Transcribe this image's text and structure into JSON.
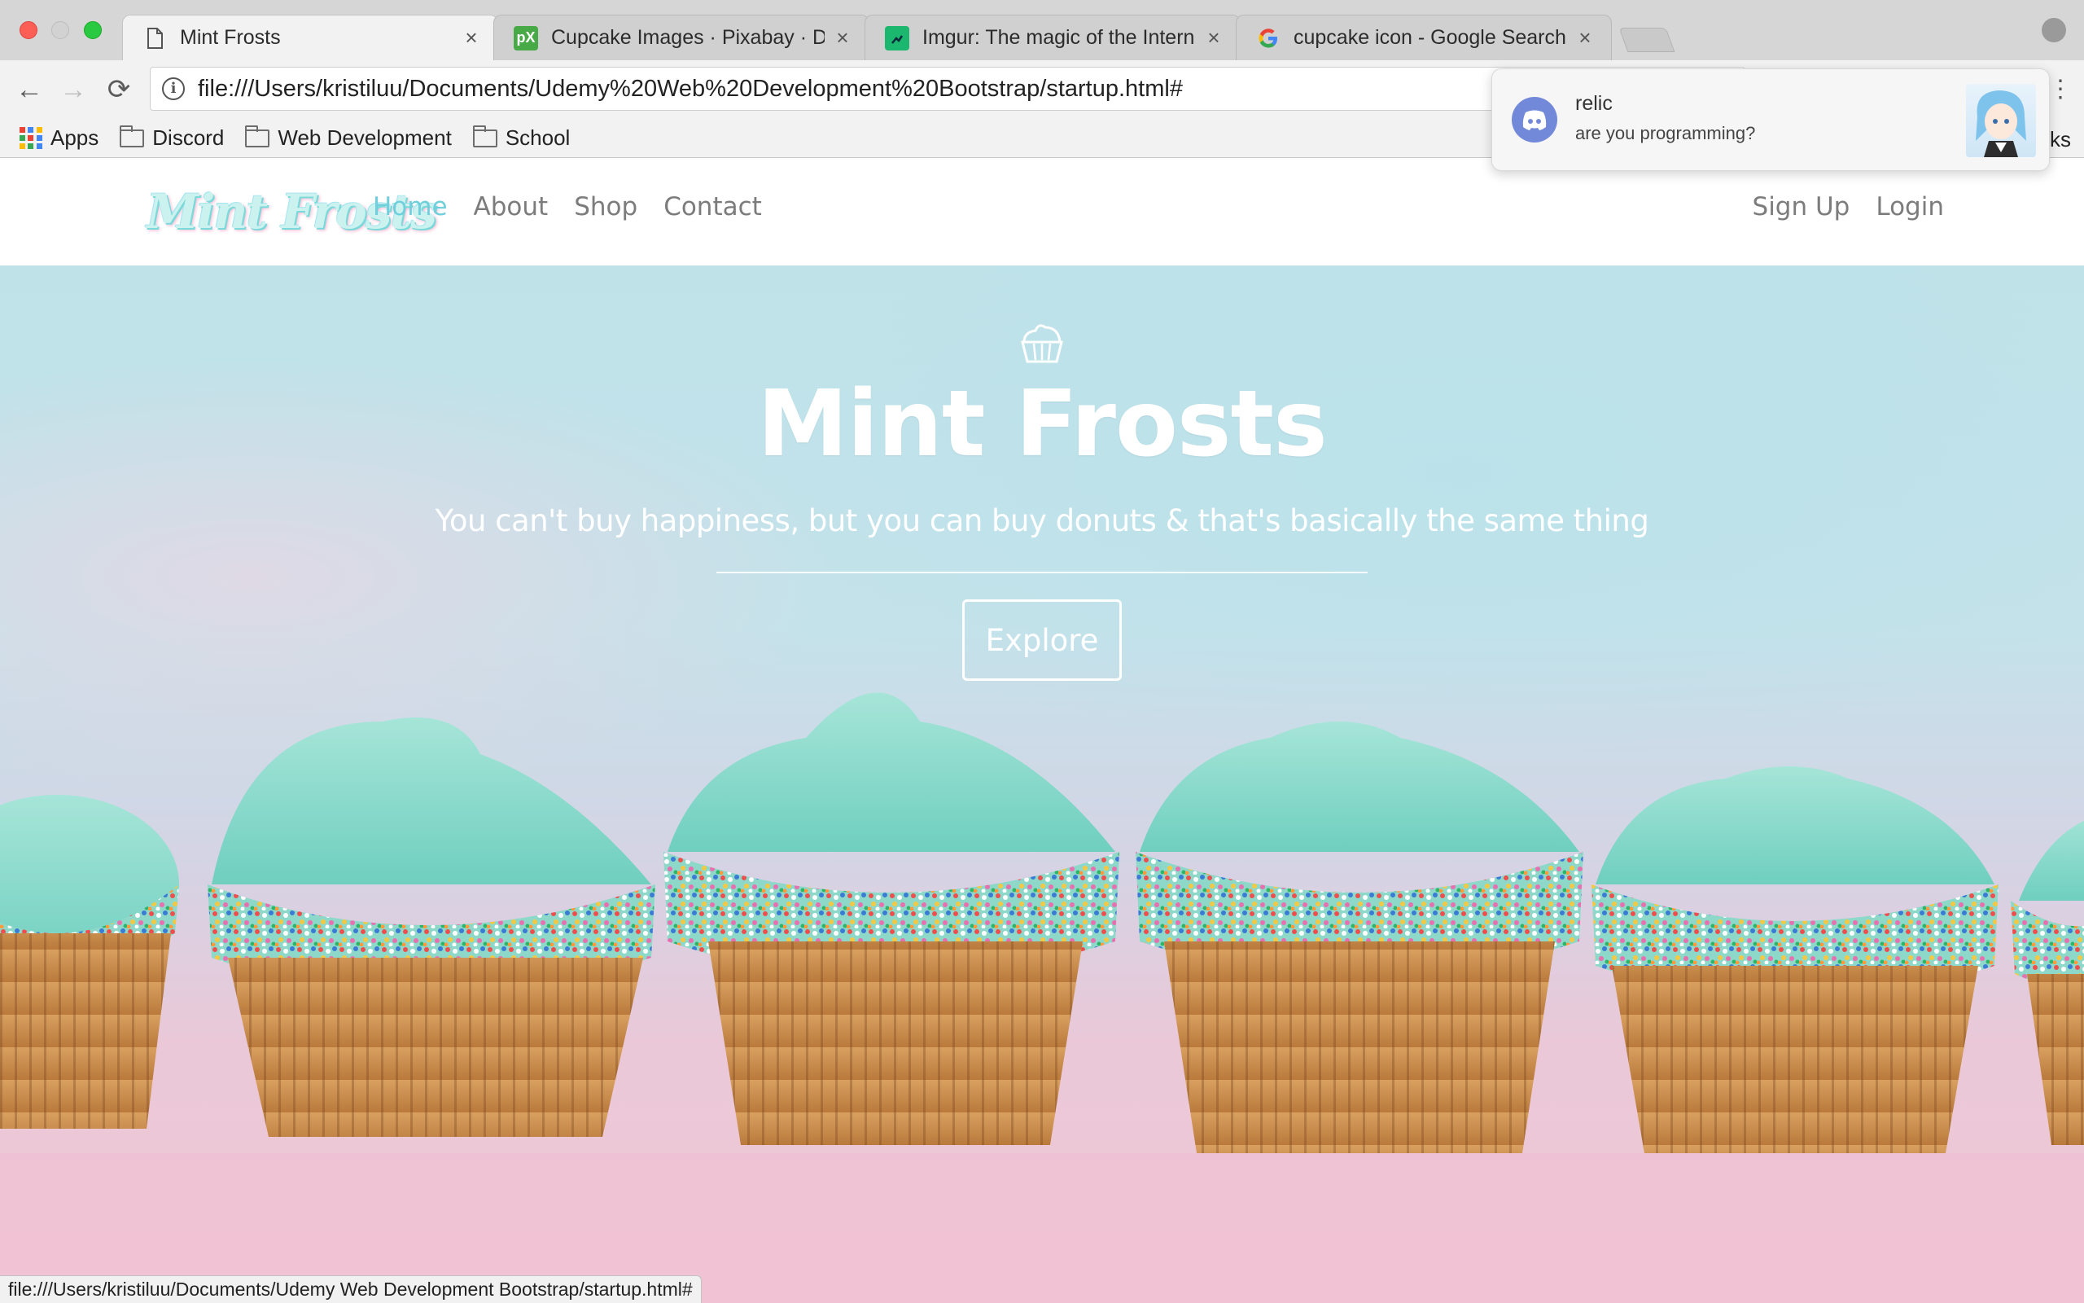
{
  "browser": {
    "tabs": [
      {
        "title": "Mint Frosts",
        "active": true,
        "icon": "page-icon"
      },
      {
        "title": "Cupcake Images · Pixabay · Do",
        "active": false,
        "icon": "pixabay-icon"
      },
      {
        "title": "Imgur: The magic of the Intern",
        "active": false,
        "icon": "imgur-icon"
      },
      {
        "title": "cupcake icon - Google Search",
        "active": false,
        "icon": "google-icon"
      }
    ],
    "url": "file:///Users/kristiluu/Documents/Udemy%20Web%20Development%20Bootstrap/startup.html#",
    "bookmarks": [
      {
        "label": "Apps",
        "icon": "apps-grid-icon"
      },
      {
        "label": "Discord",
        "icon": "folder-icon"
      },
      {
        "label": "Web Development",
        "icon": "folder-icon"
      },
      {
        "label": "School",
        "icon": "folder-icon"
      }
    ],
    "bookmarks_other_fragment": "ks",
    "status_url": "file:///Users/kristiluu/Documents/Udemy Web Development Bootstrap/startup.html#"
  },
  "site": {
    "logo_text": "Mint Frosts",
    "nav_links": [
      {
        "label": "Home",
        "active": true
      },
      {
        "label": "About",
        "active": false
      },
      {
        "label": "Shop",
        "active": false
      },
      {
        "label": "Contact",
        "active": false
      }
    ],
    "nav_right": [
      {
        "label": "Sign Up"
      },
      {
        "label": "Login"
      }
    ],
    "accent_color": "#6fcfdc"
  },
  "hero": {
    "icon": "cupcake-icon",
    "title": "Mint Frosts",
    "tagline": "You can't buy happiness, but you can buy donuts & that's basically the same thing",
    "button_label": "Explore"
  },
  "notification": {
    "app_icon": "discord-icon",
    "sender": "relic",
    "message": "are you programming?"
  }
}
